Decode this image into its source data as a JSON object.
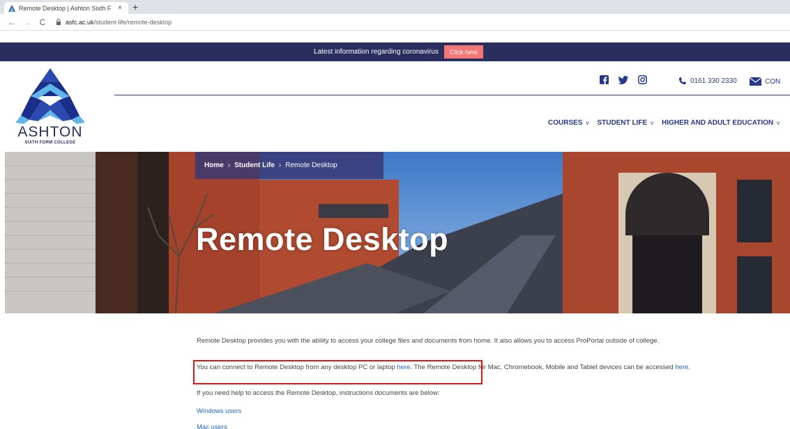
{
  "browser": {
    "tab_title": "Remote Desktop | Ashton Sixth F",
    "tab_close": "×",
    "new_tab": "+",
    "url_domain": "asfc.ac.uk",
    "url_path": "/student-life/remote-desktop"
  },
  "notice": {
    "text": "Latest information regarding coronavirus",
    "button": "Click here",
    "button_color": "#f37774",
    "bg_color": "#2a2e5f"
  },
  "header": {
    "logo_name": "ASHTON",
    "logo_sub": "SIXTH FORM COLLEGE",
    "phone": "0161 330 2330",
    "contact": "CON",
    "socials": [
      "facebook-icon",
      "twitter-icon",
      "instagram-icon"
    ],
    "accent_color": "#28388e"
  },
  "nav": {
    "items": [
      {
        "label": "COURSES"
      },
      {
        "label": "STUDENT LIFE"
      },
      {
        "label": "HIGHER AND ADULT EDUCATION"
      }
    ],
    "chevron": "v"
  },
  "breadcrumb": {
    "home": "Home",
    "parent": "Student Life",
    "current": "Remote Desktop",
    "separator": "›"
  },
  "hero": {
    "title": "Remote Desktop"
  },
  "content": {
    "p1": "Remote Desktop provides you with the ability to access your college files and documents from home. It also allows you to access ProPortal outside of college.",
    "p2_a": "You can connect to Remote Desktop from any desktop PC or laptop ",
    "p2_link1": "here",
    "p2_b": ". The Remote Desktop for Mac, Chromebook, Mobile and Tablet devices can be accessed ",
    "p2_link2": "here",
    "p2_c": ".",
    "p3": "If you need help to access the Remote Desktop, instructions documents are below:",
    "link_windows": "Windows users",
    "link_mac": "Mac users",
    "link_color": "#1a66c9",
    "highlight_color": "#e01515"
  }
}
